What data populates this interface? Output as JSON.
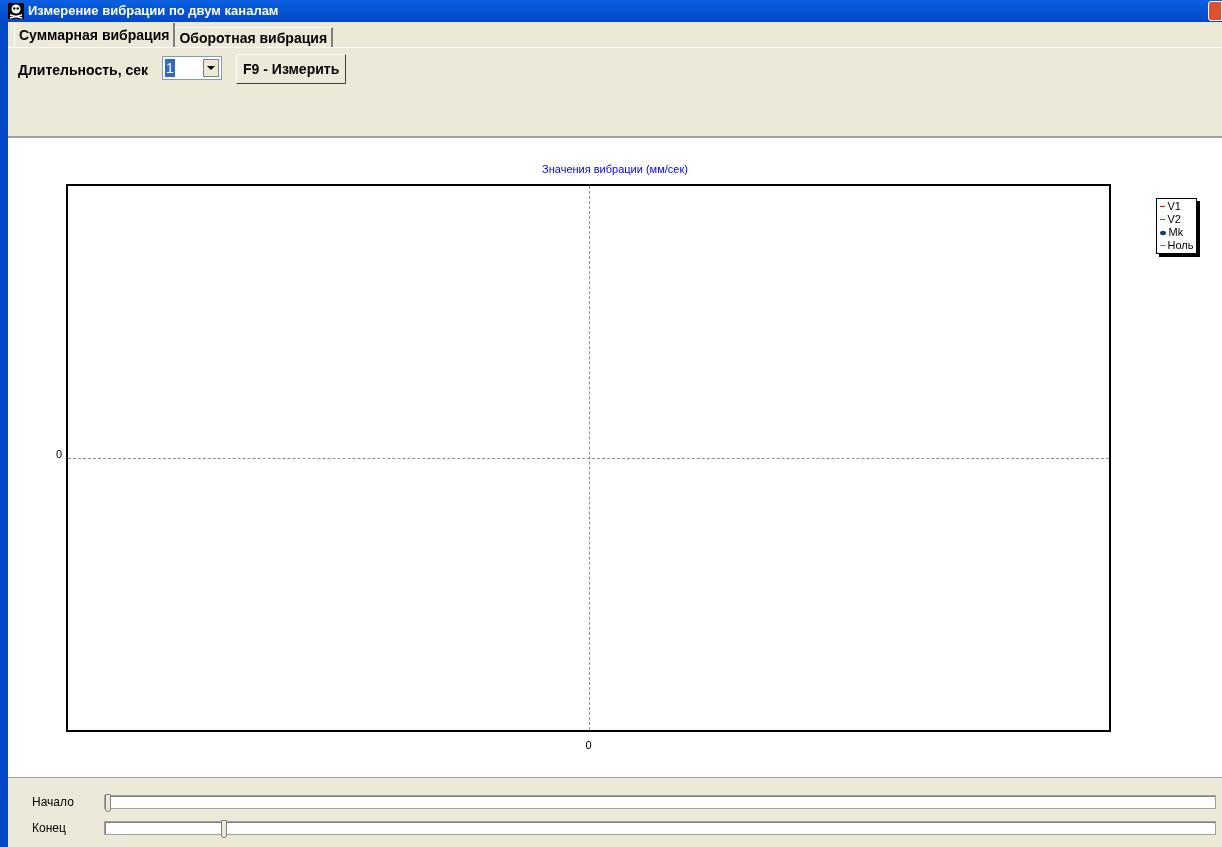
{
  "window": {
    "title": "Измерение вибрации по двум каналам"
  },
  "tabs": [
    {
      "label": "Суммарная вибрация",
      "selected": true
    },
    {
      "label": "Оборотная вибрация",
      "selected": false
    }
  ],
  "toolbar": {
    "duration_label": "Длительность, сек",
    "duration_value": "1",
    "measure_button": "F9 - Измерить"
  },
  "chart": {
    "title": "Значения вибрации  (мм/сек)",
    "y_tick": "0",
    "x_tick": "0",
    "legend": [
      {
        "label": "V1",
        "color": "#ff0000",
        "kind": "dash"
      },
      {
        "label": "V2",
        "color": "#00a000",
        "kind": "dash"
      },
      {
        "label": "Mk",
        "color": "#003a80",
        "kind": "dot"
      },
      {
        "label": "Ноль",
        "color": "#6060ff",
        "kind": "dash"
      }
    ]
  },
  "sliders": [
    {
      "label": "Начало",
      "level": 0
    },
    {
      "label": "Конец",
      "level": 0.105
    }
  ]
}
